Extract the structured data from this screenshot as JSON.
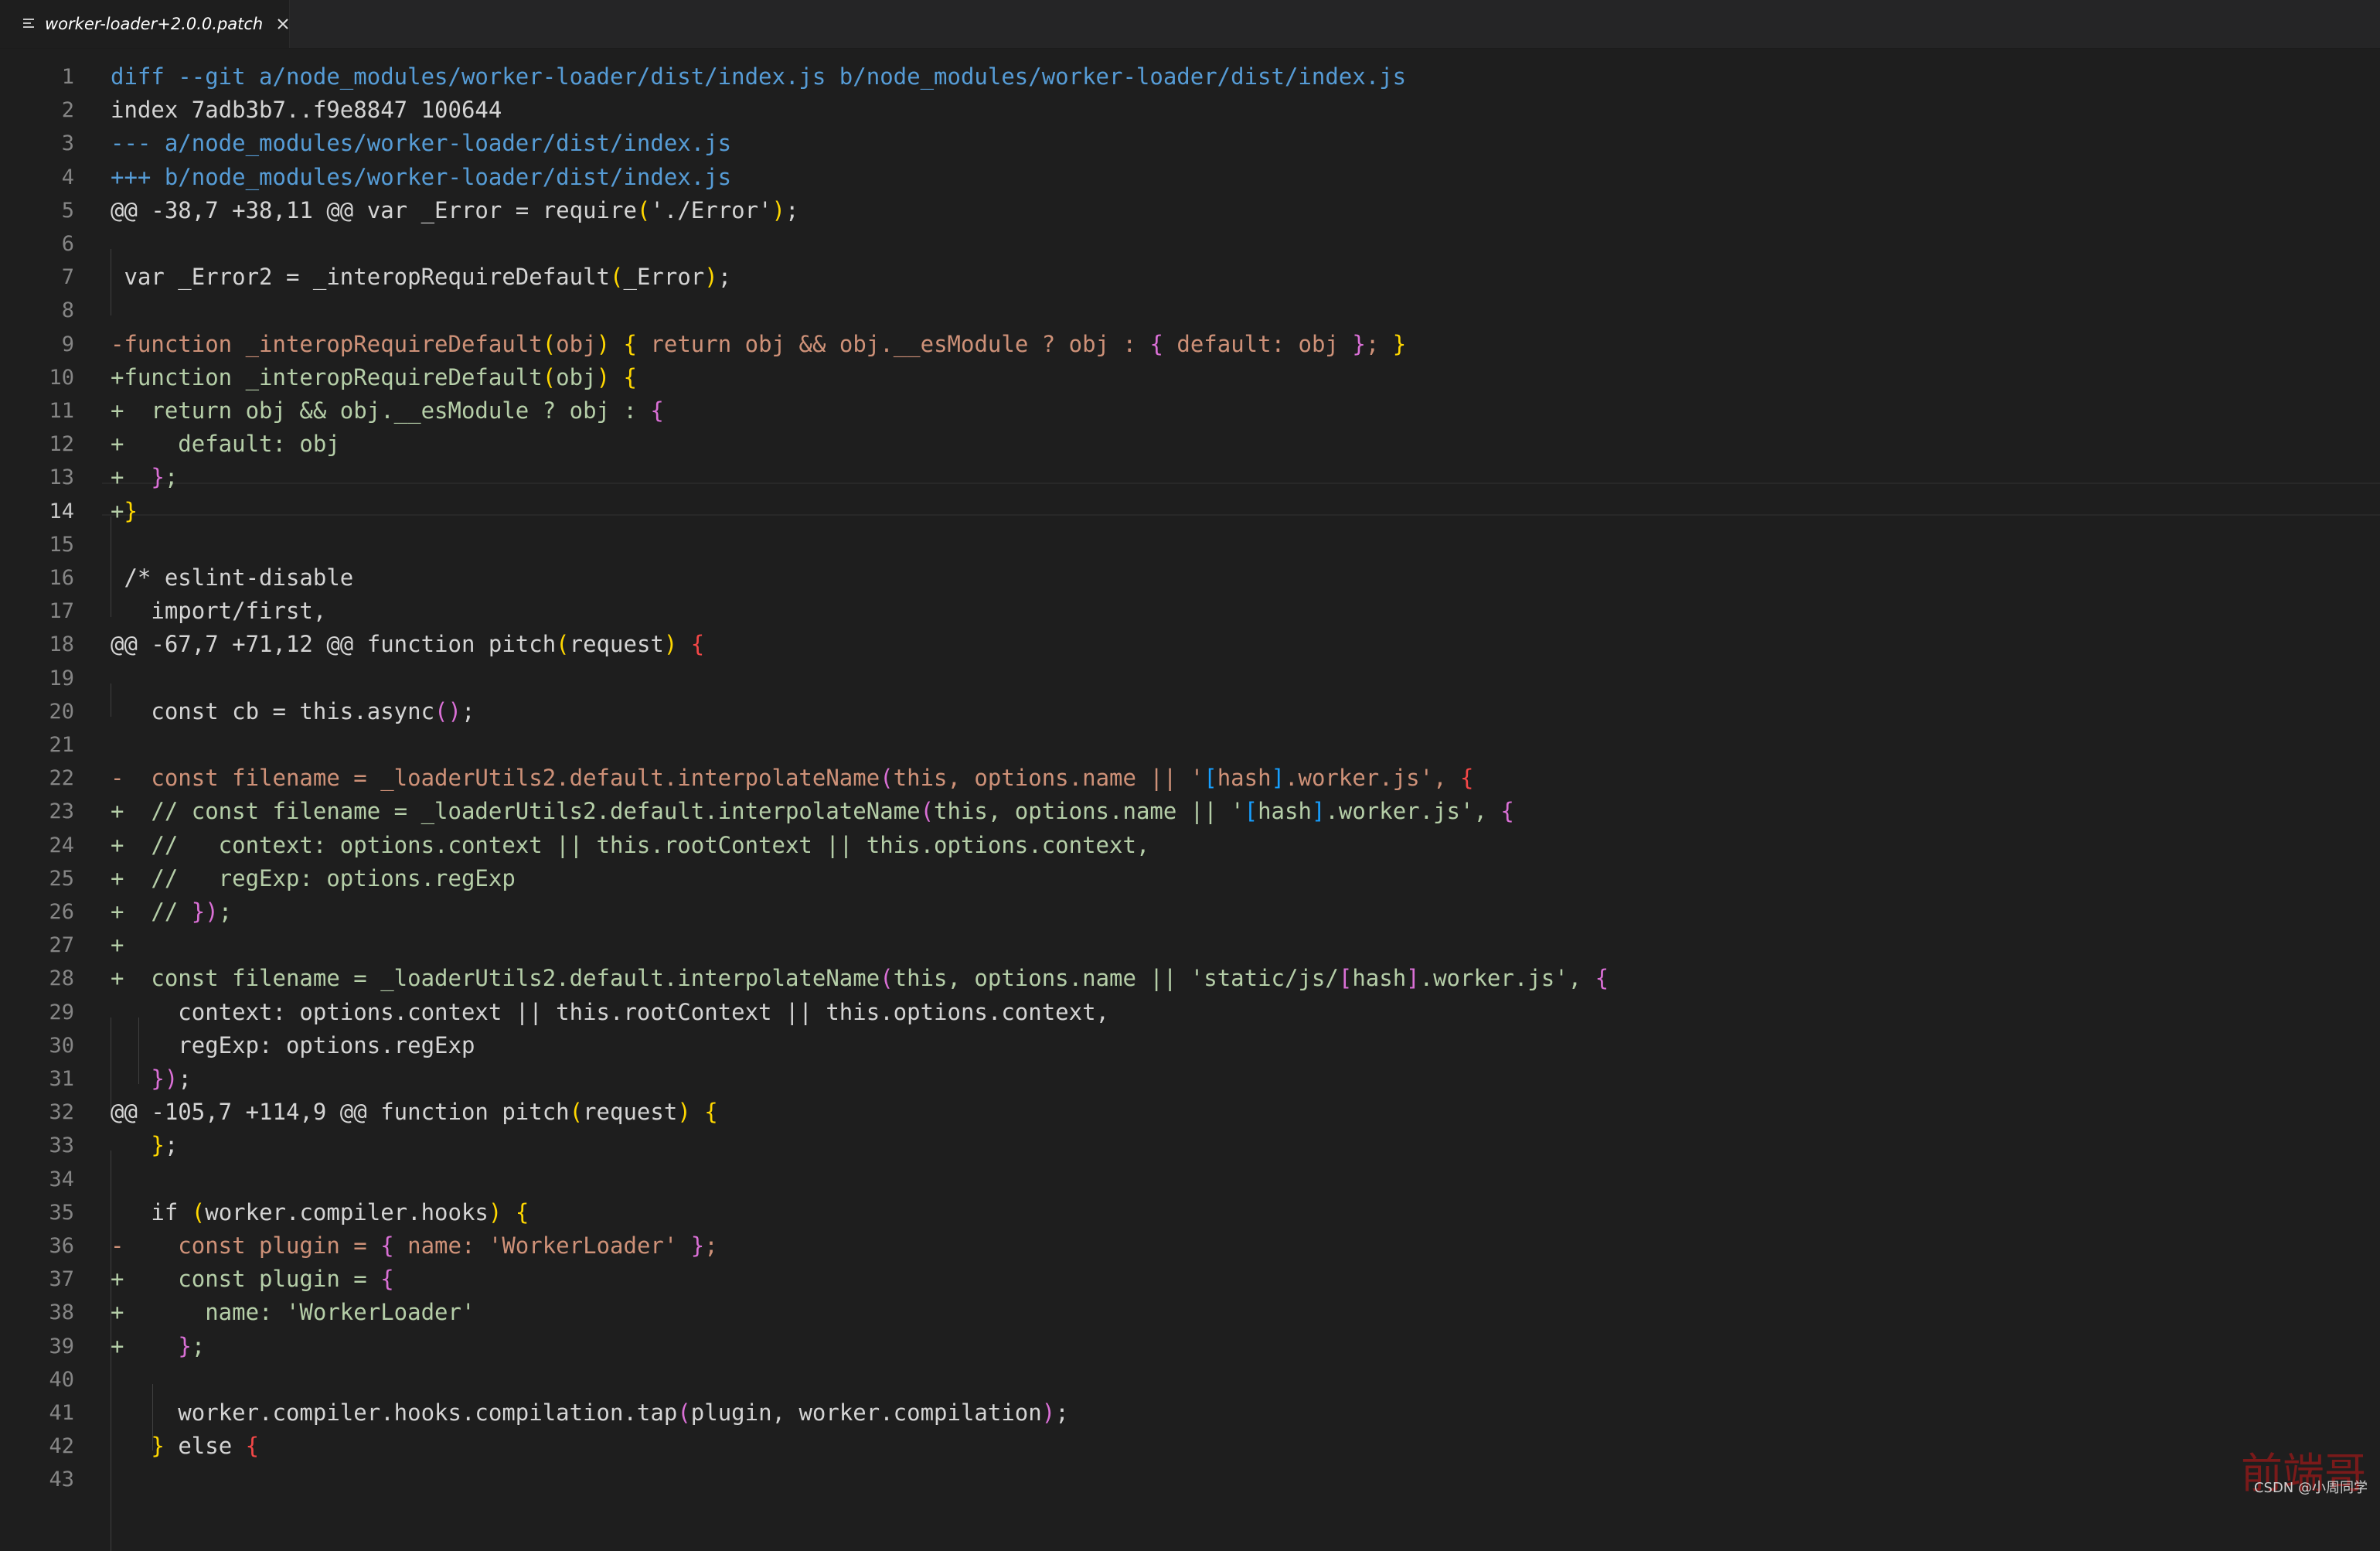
{
  "tab": {
    "title": "worker-loader+2.0.0.patch",
    "icon": "file-lines-icon",
    "close_icon": "close-icon"
  },
  "editor": {
    "active_line": 14
  },
  "colors": {
    "default": "#d4d4d4",
    "header": "#569cd6",
    "removed": "#ce9178",
    "added": "#b5cea8",
    "bracket1": "#ffd700",
    "bracket2": "#da70d6",
    "bracket3": "#179fff",
    "error": "#f44747",
    "comment": "#d4d4d4"
  },
  "lines": [
    {
      "n": "1",
      "spans": [
        {
          "t": "diff --git a/node_modules/worker-loader/dist/index.js b/node_modules/worker-loader/dist/index.js",
          "c": "header"
        }
      ]
    },
    {
      "n": "2",
      "spans": [
        {
          "t": "index 7adb3b7..f9e8847 100644",
          "c": "default"
        }
      ]
    },
    {
      "n": "3",
      "spans": [
        {
          "t": "--- a/node_modules/worker-loader/dist/index.js",
          "c": "header"
        }
      ]
    },
    {
      "n": "4",
      "spans": [
        {
          "t": "+++ b/node_modules/worker-loader/dist/index.js",
          "c": "header"
        }
      ]
    },
    {
      "n": "5",
      "spans": [
        {
          "t": "@@ -38,7 +38,11 @@ var _Error = require",
          "c": "default"
        },
        {
          "t": "(",
          "c": "bracket1"
        },
        {
          "t": "'./Error'",
          "c": "default"
        },
        {
          "t": ")",
          "c": "bracket1"
        },
        {
          "t": ";",
          "c": "default"
        }
      ]
    },
    {
      "n": "6",
      "spans": []
    },
    {
      "n": "7",
      "spans": [
        {
          "t": " var _Error2 = _interopRequireDefault",
          "c": "default"
        },
        {
          "t": "(",
          "c": "bracket1"
        },
        {
          "t": "_Error",
          "c": "default"
        },
        {
          "t": ")",
          "c": "bracket1"
        },
        {
          "t": ";",
          "c": "default"
        }
      ]
    },
    {
      "n": "8",
      "spans": []
    },
    {
      "n": "9",
      "spans": [
        {
          "t": "-function _interopRequireDefault",
          "c": "removed"
        },
        {
          "t": "(",
          "c": "bracket1"
        },
        {
          "t": "obj",
          "c": "removed"
        },
        {
          "t": ")",
          "c": "bracket1"
        },
        {
          "t": " ",
          "c": "removed"
        },
        {
          "t": "{",
          "c": "bracket1"
        },
        {
          "t": " return obj && obj.__esModule ? obj : ",
          "c": "removed"
        },
        {
          "t": "{",
          "c": "bracket2"
        },
        {
          "t": " default: obj ",
          "c": "removed"
        },
        {
          "t": "}",
          "c": "bracket2"
        },
        {
          "t": "; ",
          "c": "removed"
        },
        {
          "t": "}",
          "c": "bracket1"
        }
      ]
    },
    {
      "n": "10",
      "spans": [
        {
          "t": "+function _interopRequireDefault",
          "c": "added"
        },
        {
          "t": "(",
          "c": "bracket1"
        },
        {
          "t": "obj",
          "c": "added"
        },
        {
          "t": ")",
          "c": "bracket1"
        },
        {
          "t": " ",
          "c": "added"
        },
        {
          "t": "{",
          "c": "bracket1"
        }
      ]
    },
    {
      "n": "11",
      "spans": [
        {
          "t": "+  return obj && obj.__esModule ? obj : ",
          "c": "added"
        },
        {
          "t": "{",
          "c": "bracket2"
        }
      ]
    },
    {
      "n": "12",
      "spans": [
        {
          "t": "+    default: obj",
          "c": "added"
        }
      ]
    },
    {
      "n": "13",
      "spans": [
        {
          "t": "+  ",
          "c": "added"
        },
        {
          "t": "}",
          "c": "bracket2"
        },
        {
          "t": ";",
          "c": "added"
        }
      ]
    },
    {
      "n": "14",
      "spans": [
        {
          "t": "+",
          "c": "added"
        },
        {
          "t": "}",
          "c": "bracket1"
        }
      ]
    },
    {
      "n": "15",
      "spans": []
    },
    {
      "n": "16",
      "spans": [
        {
          "t": " /* eslint-disable",
          "c": "comment"
        }
      ]
    },
    {
      "n": "17",
      "spans": [
        {
          "t": "   import/first,",
          "c": "comment"
        }
      ]
    },
    {
      "n": "18",
      "spans": [
        {
          "t": "@@ -67,7 +71,12 @@ function pitch",
          "c": "default"
        },
        {
          "t": "(",
          "c": "bracket1"
        },
        {
          "t": "request",
          "c": "default"
        },
        {
          "t": ")",
          "c": "bracket1"
        },
        {
          "t": " ",
          "c": "default"
        },
        {
          "t": "{",
          "c": "error"
        }
      ]
    },
    {
      "n": "19",
      "spans": []
    },
    {
      "n": "20",
      "spans": [
        {
          "t": "   const cb = this.async",
          "c": "default"
        },
        {
          "t": "()",
          "c": "bracket2"
        },
        {
          "t": ";",
          "c": "default"
        }
      ]
    },
    {
      "n": "21",
      "spans": []
    },
    {
      "n": "22",
      "spans": [
        {
          "t": "-  const filename = _loaderUtils2.default.interpolateName",
          "c": "removed"
        },
        {
          "t": "(",
          "c": "bracket2"
        },
        {
          "t": "this, options.name || '",
          "c": "removed"
        },
        {
          "t": "[",
          "c": "bracket3"
        },
        {
          "t": "hash",
          "c": "removed"
        },
        {
          "t": "]",
          "c": "bracket3"
        },
        {
          "t": ".worker.js', ",
          "c": "removed"
        },
        {
          "t": "{",
          "c": "error"
        }
      ]
    },
    {
      "n": "23",
      "spans": [
        {
          "t": "+  // const filename = _loaderUtils2.default.interpolateName",
          "c": "added"
        },
        {
          "t": "(",
          "c": "bracket2"
        },
        {
          "t": "this, options.name || '",
          "c": "added"
        },
        {
          "t": "[",
          "c": "bracket3"
        },
        {
          "t": "hash",
          "c": "added"
        },
        {
          "t": "]",
          "c": "bracket3"
        },
        {
          "t": ".worker.js', ",
          "c": "added"
        },
        {
          "t": "{",
          "c": "bracket2"
        }
      ]
    },
    {
      "n": "24",
      "spans": [
        {
          "t": "+  //   context: options.context || this.rootContext || this.options.context,",
          "c": "added"
        }
      ]
    },
    {
      "n": "25",
      "spans": [
        {
          "t": "+  //   regExp: options.regExp",
          "c": "added"
        }
      ]
    },
    {
      "n": "26",
      "spans": [
        {
          "t": "+  // ",
          "c": "added"
        },
        {
          "t": "}",
          "c": "bracket2"
        },
        {
          "t": ")",
          "c": "bracket2"
        },
        {
          "t": ";",
          "c": "added"
        }
      ]
    },
    {
      "n": "27",
      "spans": [
        {
          "t": "+",
          "c": "added"
        }
      ]
    },
    {
      "n": "28",
      "spans": [
        {
          "t": "+  const filename = _loaderUtils2.default.interpolateName",
          "c": "added"
        },
        {
          "t": "(",
          "c": "bracket2"
        },
        {
          "t": "this, options.name || 'static/js/",
          "c": "added"
        },
        {
          "t": "[",
          "c": "bracket2"
        },
        {
          "t": "hash",
          "c": "added"
        },
        {
          "t": "]",
          "c": "bracket2"
        },
        {
          "t": ".worker.js', ",
          "c": "added"
        },
        {
          "t": "{",
          "c": "bracket2"
        }
      ]
    },
    {
      "n": "29",
      "spans": [
        {
          "t": "     context: options.context || this.rootContext || this.options.context,",
          "c": "default"
        }
      ]
    },
    {
      "n": "30",
      "spans": [
        {
          "t": "     regExp: options.regExp",
          "c": "default"
        }
      ]
    },
    {
      "n": "31",
      "spans": [
        {
          "t": "   ",
          "c": "default"
        },
        {
          "t": "}",
          "c": "bracket2"
        },
        {
          "t": ")",
          "c": "bracket2"
        },
        {
          "t": ";",
          "c": "default"
        }
      ]
    },
    {
      "n": "32",
      "spans": [
        {
          "t": "@@ -105,7 +114,9 @@ function pitch",
          "c": "default"
        },
        {
          "t": "(",
          "c": "bracket1"
        },
        {
          "t": "request",
          "c": "default"
        },
        {
          "t": ")",
          "c": "bracket1"
        },
        {
          "t": " ",
          "c": "default"
        },
        {
          "t": "{",
          "c": "bracket1"
        }
      ]
    },
    {
      "n": "33",
      "spans": [
        {
          "t": "   ",
          "c": "default"
        },
        {
          "t": "}",
          "c": "bracket1"
        },
        {
          "t": ";",
          "c": "default"
        }
      ]
    },
    {
      "n": "34",
      "spans": []
    },
    {
      "n": "35",
      "spans": [
        {
          "t": "   if ",
          "c": "default"
        },
        {
          "t": "(",
          "c": "bracket1"
        },
        {
          "t": "worker.compiler.hooks",
          "c": "default"
        },
        {
          "t": ")",
          "c": "bracket1"
        },
        {
          "t": " ",
          "c": "default"
        },
        {
          "t": "{",
          "c": "bracket1"
        }
      ]
    },
    {
      "n": "36",
      "spans": [
        {
          "t": "-    const plugin = ",
          "c": "removed"
        },
        {
          "t": "{",
          "c": "bracket2"
        },
        {
          "t": " name: 'WorkerLoader' ",
          "c": "removed"
        },
        {
          "t": "}",
          "c": "bracket2"
        },
        {
          "t": ";",
          "c": "removed"
        }
      ]
    },
    {
      "n": "37",
      "spans": [
        {
          "t": "+    const plugin = ",
          "c": "added"
        },
        {
          "t": "{",
          "c": "bracket2"
        }
      ]
    },
    {
      "n": "38",
      "spans": [
        {
          "t": "+      name: 'WorkerLoader'",
          "c": "added"
        }
      ]
    },
    {
      "n": "39",
      "spans": [
        {
          "t": "+    ",
          "c": "added"
        },
        {
          "t": "}",
          "c": "bracket2"
        },
        {
          "t": ";",
          "c": "added"
        }
      ]
    },
    {
      "n": "40",
      "spans": []
    },
    {
      "n": "41",
      "spans": [
        {
          "t": "     worker.compiler.hooks.compilation.tap",
          "c": "default"
        },
        {
          "t": "(",
          "c": "bracket2"
        },
        {
          "t": "plugin, worker.compilation",
          "c": "default"
        },
        {
          "t": ")",
          "c": "bracket2"
        },
        {
          "t": ";",
          "c": "default"
        }
      ]
    },
    {
      "n": "42",
      "spans": [
        {
          "t": "   ",
          "c": "default"
        },
        {
          "t": "}",
          "c": "bracket1"
        },
        {
          "t": " else ",
          "c": "default"
        },
        {
          "t": "{",
          "c": "error"
        }
      ]
    },
    {
      "n": "43",
      "spans": []
    }
  ],
  "watermark": {
    "logo": "前端哥",
    "text": "CSDN @小周同学"
  }
}
